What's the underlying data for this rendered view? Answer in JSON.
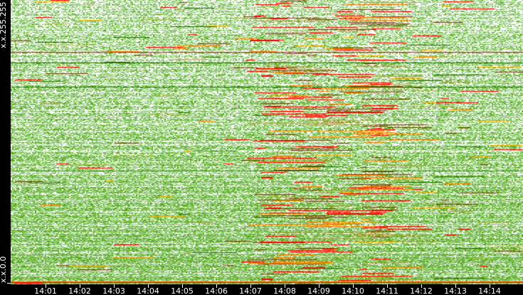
{
  "chart_data": {
    "type": "heatmap",
    "title": "",
    "xlabel": "",
    "ylabel": "",
    "y_tick_labels": {
      "top": "x.x.255.255",
      "bottom": "x.x.0.0"
    },
    "x_tick_labels": [
      "14:01",
      "14:02",
      "14:03",
      "14:04",
      "14:05",
      "14:06",
      "14:07",
      "14:08",
      "14:09",
      "14:10",
      "14:11",
      "14:12",
      "14:13",
      "14:14"
    ],
    "x_range": [
      "14:00",
      "14:15"
    ],
    "color_scale": [
      "#ffffff",
      "#9fd38a",
      "#7cc24f",
      "#5aa81c",
      "#1f6e00",
      "#f0b000",
      "#ff8000",
      "#ff0000"
    ],
    "hotspot_range": [
      "14:06:40",
      "14:10:00"
    ],
    "grid": false,
    "legend": "none"
  }
}
